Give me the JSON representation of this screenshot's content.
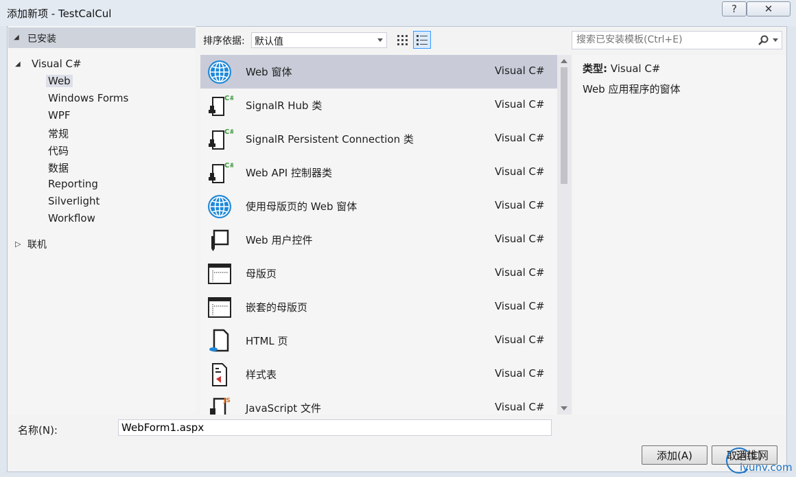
{
  "window": {
    "title": "添加新项 - TestCalCul",
    "help_glyph": "?",
    "close_glyph": "✕"
  },
  "tree": {
    "installed_label": "已安装",
    "visual_csharp_label": "Visual C#",
    "children": [
      "Web",
      "Windows Forms",
      "WPF",
      "常规",
      "代码",
      "数据",
      "Reporting",
      "Silverlight",
      "Workflow"
    ],
    "online_label": "联机"
  },
  "toolbar": {
    "sort_label": "排序依据:",
    "sort_value": "默认值"
  },
  "search": {
    "placeholder": "搜索已安装模板(Ctrl+E)"
  },
  "templates": [
    {
      "name": "Web 窗体",
      "lang": "Visual C#",
      "icon": "globe-icon"
    },
    {
      "name": "SignalR Hub 类",
      "lang": "Visual C#",
      "icon": "csharp-class-icon"
    },
    {
      "name": "SignalR Persistent Connection 类",
      "lang": "Visual C#",
      "icon": "csharp-class-icon"
    },
    {
      "name": "Web API 控制器类",
      "lang": "Visual C#",
      "icon": "csharp-class-icon"
    },
    {
      "name": "使用母版页的 Web 窗体",
      "lang": "Visual C#",
      "icon": "globe-icon"
    },
    {
      "name": "Web 用户控件",
      "lang": "Visual C#",
      "icon": "user-control-icon"
    },
    {
      "name": "母版页",
      "lang": "Visual C#",
      "icon": "master-page-icon"
    },
    {
      "name": "嵌套的母版页",
      "lang": "Visual C#",
      "icon": "master-page-icon"
    },
    {
      "name": "HTML 页",
      "lang": "Visual C#",
      "icon": "html-page-icon"
    },
    {
      "name": "样式表",
      "lang": "Visual C#",
      "icon": "stylesheet-icon"
    },
    {
      "name": "JavaScript 文件",
      "lang": "Visual C#",
      "icon": "javascript-file-icon"
    }
  ],
  "details": {
    "type_label": "类型:",
    "type_value": "Visual C#",
    "description": "Web 应用程序的窗体"
  },
  "name_field": {
    "label": "名称(N):",
    "value": "WebForm1.aspx"
  },
  "buttons": {
    "add": "添加(A)",
    "cancel": "取消(C)"
  },
  "watermark": {
    "line1": "运维网",
    "line2": "iyunv.com"
  },
  "colors": {
    "selection": "#c9ccd8",
    "accent_blue": "#1a73c7"
  }
}
